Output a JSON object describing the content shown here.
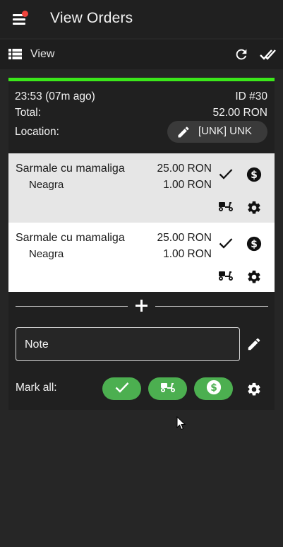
{
  "app": {
    "title": "View Orders"
  },
  "toolbar": {
    "view_label": "View"
  },
  "order": {
    "time_text": "23:53 (07m ago)",
    "id_text": "ID #30",
    "total_label": "Total:",
    "total_value": "52.00 RON",
    "location_label": "Location:",
    "location_value": "[UNK] UNK",
    "items": [
      {
        "name": "Sarmale cu mamaliga",
        "price": "25.00 RON",
        "sub_name": "Neagra",
        "sub_price": "1.00 RON"
      },
      {
        "name": "Sarmale cu mamaliga",
        "price": "25.00 RON",
        "sub_name": "Neagra",
        "sub_price": "1.00 RON"
      }
    ],
    "note_label": "Note",
    "mark_all_label": "Mark all:"
  },
  "colors": {
    "status_bar": "#3be81a",
    "pill_green": "#4caf50",
    "notification_dot": "#f0443c",
    "app_background": "#262626"
  },
  "icons": {
    "menu": "hamburger-icon",
    "list": "list-icon",
    "refresh": "refresh-icon",
    "mark_done": "double-check-icon",
    "edit": "pencil-icon",
    "check": "check-icon",
    "paid": "dollar-icon",
    "delivery": "scooter-icon",
    "settings": "gear-icon",
    "add": "plus-icon",
    "cursor": "mouse-cursor-icon"
  }
}
